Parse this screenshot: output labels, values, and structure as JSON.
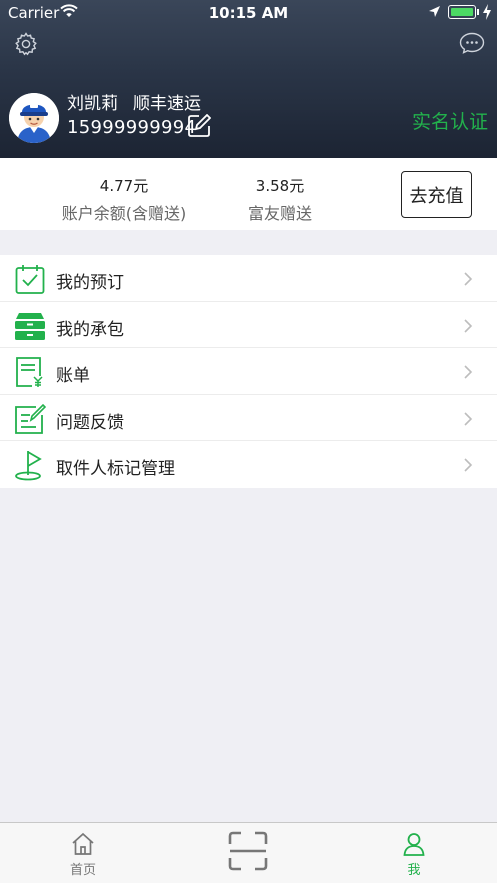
{
  "status_bar": {
    "carrier": "Carrier",
    "time": "10:15 AM"
  },
  "profile": {
    "name": "刘凯莉",
    "company": "顺丰速运",
    "phone": "15999999994",
    "verify_label": "实名认证"
  },
  "balance": {
    "account_value": "4.77元",
    "account_label": "账户余额(含赠送)",
    "gift_value": "3.58元",
    "gift_label": "富友赠送",
    "recharge_label": "去充值"
  },
  "menu": [
    {
      "label": "我的预订",
      "icon": "calendar-check-icon"
    },
    {
      "label": "我的承包",
      "icon": "drawer-icon"
    },
    {
      "label": "账单",
      "icon": "bill-icon"
    },
    {
      "label": "问题反馈",
      "icon": "feedback-icon"
    },
    {
      "label": "取件人标记管理",
      "icon": "flag-icon"
    }
  ],
  "tabs": [
    {
      "label": "首页",
      "icon": "home-icon"
    },
    {
      "label": "",
      "icon": "scan-icon"
    },
    {
      "label": "我",
      "icon": "person-icon"
    }
  ],
  "colors": {
    "accent": "#22b14c",
    "header_dark": "#1c2433",
    "inactive_tab": "#777777"
  }
}
